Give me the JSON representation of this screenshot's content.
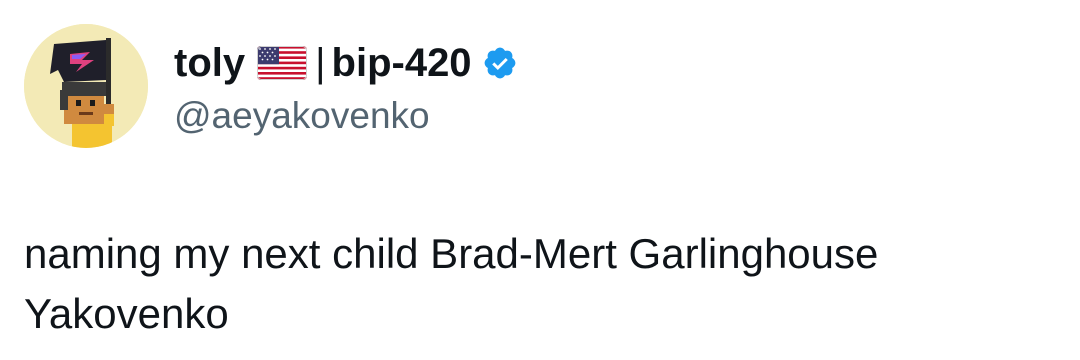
{
  "author": {
    "name_before_flag": "toly",
    "flag_icon": "us-flag-icon",
    "separator": "|",
    "name_after_flag": "bip-420",
    "verified_icon": "verified-badge-icon",
    "verified_color": "#1d9bf0",
    "handle": "@aeyakovenko"
  },
  "avatar": {
    "icon": "pixel-art-avatar-with-flag",
    "background_color": "#f3eab6"
  },
  "tweet": {
    "text": "naming my next child Brad-Mert Garlinghouse Yakovenko"
  },
  "colors": {
    "primary_text": "#0f1419",
    "secondary_text": "#536471"
  }
}
